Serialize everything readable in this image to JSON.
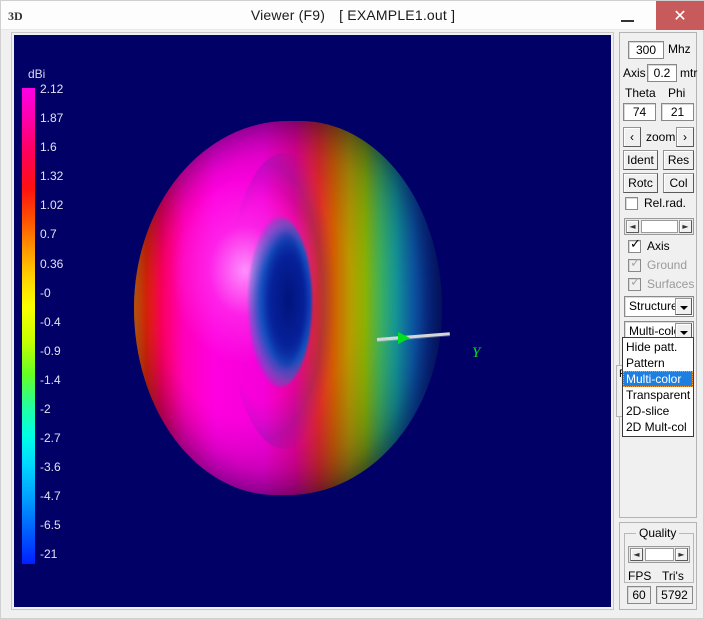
{
  "window": {
    "app_icon": "3D",
    "title": "Viewer (F9)",
    "filename": "[  EXAMPLE1.out  ]",
    "minimize_glyph": "minimize-icon",
    "maximize_glyph": "maximize-icon",
    "close_glyph": "✕",
    "close_color": "#c75b5b"
  },
  "canvas": {
    "background": "#000066",
    "axis_label": "Y"
  },
  "colorbar": {
    "title": "dBi",
    "unit": "dBi",
    "labels": [
      "2.12",
      "1.87",
      "1.6",
      "1.32",
      "1.02",
      "0.7",
      "0.36",
      "-0",
      "-0.4",
      "-0.9",
      "-1.4",
      "-2",
      "-2.7",
      "-3.6",
      "-4.7",
      "-6.5",
      "-21"
    ],
    "max": "2.12",
    "min": "-21",
    "top_color": "#ff00e6",
    "bottom_color": "#0020ff"
  },
  "panel": {
    "frequency": {
      "value": "300",
      "unit": "Mhz"
    },
    "axis": {
      "label": "Axis",
      "value": "0.2",
      "unit": "mtr"
    },
    "theta": {
      "label": "Theta",
      "value": "74"
    },
    "phi": {
      "label": "Phi",
      "value": "21"
    },
    "zoom": {
      "label": "zoom",
      "prev": "‹",
      "next": "›"
    },
    "buttons": {
      "ident": "Ident",
      "res": "Res",
      "rotc": "Rotc",
      "col": "Col"
    },
    "rel_rad": {
      "label": "Rel.rad.",
      "checked": false
    },
    "slider_top": {
      "left_arrow": "◄",
      "right_arrow": "►"
    },
    "checkboxes": [
      {
        "label": "Axis",
        "checked": true,
        "enabled": true
      },
      {
        "label": "Ground",
        "checked": true,
        "enabled": false
      },
      {
        "label": "Surfaces",
        "checked": true,
        "enabled": false
      }
    ],
    "combo_view": {
      "value": "Structure"
    },
    "combo_mode": {
      "value": "Multi-colo"
    },
    "dropdown_options": [
      "Hide patt.",
      "Pattern",
      "Multi-color",
      "Transparent",
      "2D-slice",
      "2D Mult-col"
    ],
    "dropdown_selected": "Multi-color",
    "hidden_group_label": "R"
  },
  "quality": {
    "title": "Quality",
    "left_arrow": "◄",
    "right_arrow": "►",
    "fps_label": "FPS",
    "fps_value": "60",
    "tris_label": "Tri's",
    "tris_value": "5792"
  }
}
